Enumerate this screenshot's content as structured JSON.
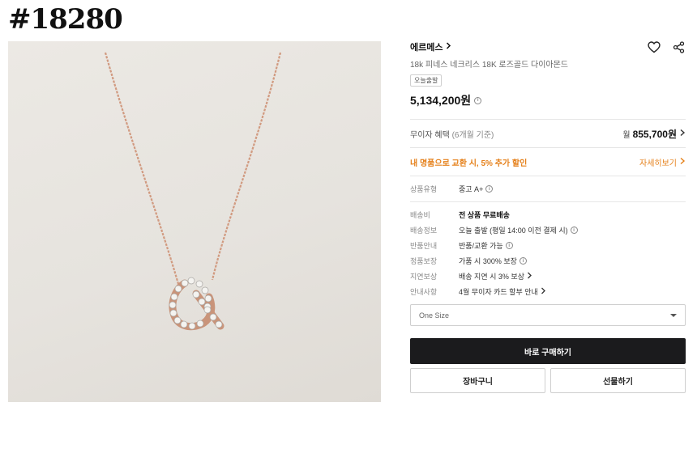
{
  "page_tag": "#18280",
  "product": {
    "brand": "에르메스",
    "name": "18k 피네스 네크리스 18K 로즈골드 다이아몬드",
    "badge": "오늘출발",
    "price": "5,134,200원"
  },
  "installment": {
    "label": "무이자 혜택",
    "sub": "(6개월 기준)",
    "won": "월",
    "amount": "855,700원"
  },
  "trade_in": {
    "text": "내 명품으로 교환 시, 5% 추가 할인",
    "link": "자세히보기"
  },
  "condition": {
    "key": "상품유형",
    "value": "중고 A+"
  },
  "specs": [
    {
      "key": "배송비",
      "value": "전 상품 무료배송"
    },
    {
      "key": "배송정보",
      "value": "오늘 출발 (평일 14:00 이전 결제 시)"
    },
    {
      "key": "반품안내",
      "value": "반품/교환 가능"
    },
    {
      "key": "정품보장",
      "value": "가품 시 300% 보장"
    },
    {
      "key": "지연보상",
      "value": "배송 지연 시 3% 보상"
    },
    {
      "key": "안내사항",
      "value": "4월 무이자 카드 할부 안내"
    }
  ],
  "option_select": {
    "value": "One Size"
  },
  "buttons": {
    "buy_now": "바로 구매하기",
    "cart": "장바구니",
    "gift": "선물하기"
  },
  "colors": {
    "accent": "#e5801a",
    "buy_bg": "#1b1b1d",
    "chain": "#d4a088"
  }
}
